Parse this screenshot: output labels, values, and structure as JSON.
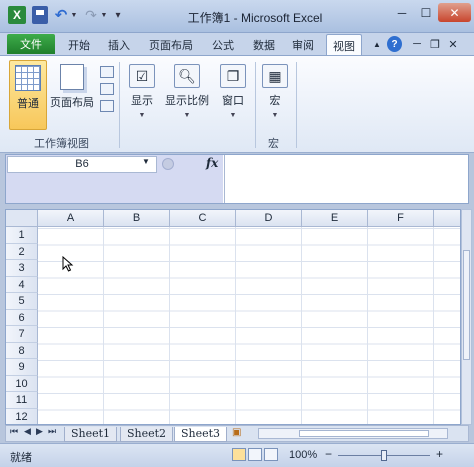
{
  "window": {
    "title": "工作簿1 - Microsoft Excel",
    "app_icon": "X",
    "min": "─",
    "max": "☐",
    "close": "✕"
  },
  "ribbon_tabs": {
    "file": "文件",
    "items": [
      "开始",
      "插入",
      "页面布局",
      "公式",
      "数据",
      "审阅",
      "视图"
    ],
    "active": "视图"
  },
  "ribbon": {
    "normal": "普通",
    "page_layout": "页面布局",
    "show": "显示",
    "zoom": "显示比例",
    "window": "窗口",
    "macro": "宏",
    "group_views": "工作簿视图",
    "group_macro": "宏"
  },
  "formula_bar": {
    "name_box": "B6",
    "fx": "fx",
    "formula": ""
  },
  "grid": {
    "columns": [
      "A",
      "B",
      "C",
      "D",
      "E",
      "F"
    ],
    "rows": [
      "1",
      "2",
      "3",
      "4",
      "5",
      "6",
      "7",
      "8",
      "9",
      "10",
      "11",
      "12"
    ]
  },
  "sheets": {
    "tabs": [
      "Sheet1",
      "Sheet2",
      "Sheet3"
    ],
    "active": "Sheet3"
  },
  "status": {
    "text": "就绪",
    "zoom": "100%",
    "zoom_fraction": 0.5,
    "minus": "−",
    "plus": "+"
  },
  "colors": {
    "file_tab": "#2a8a3c",
    "active_view_button": "#f7c75a"
  }
}
